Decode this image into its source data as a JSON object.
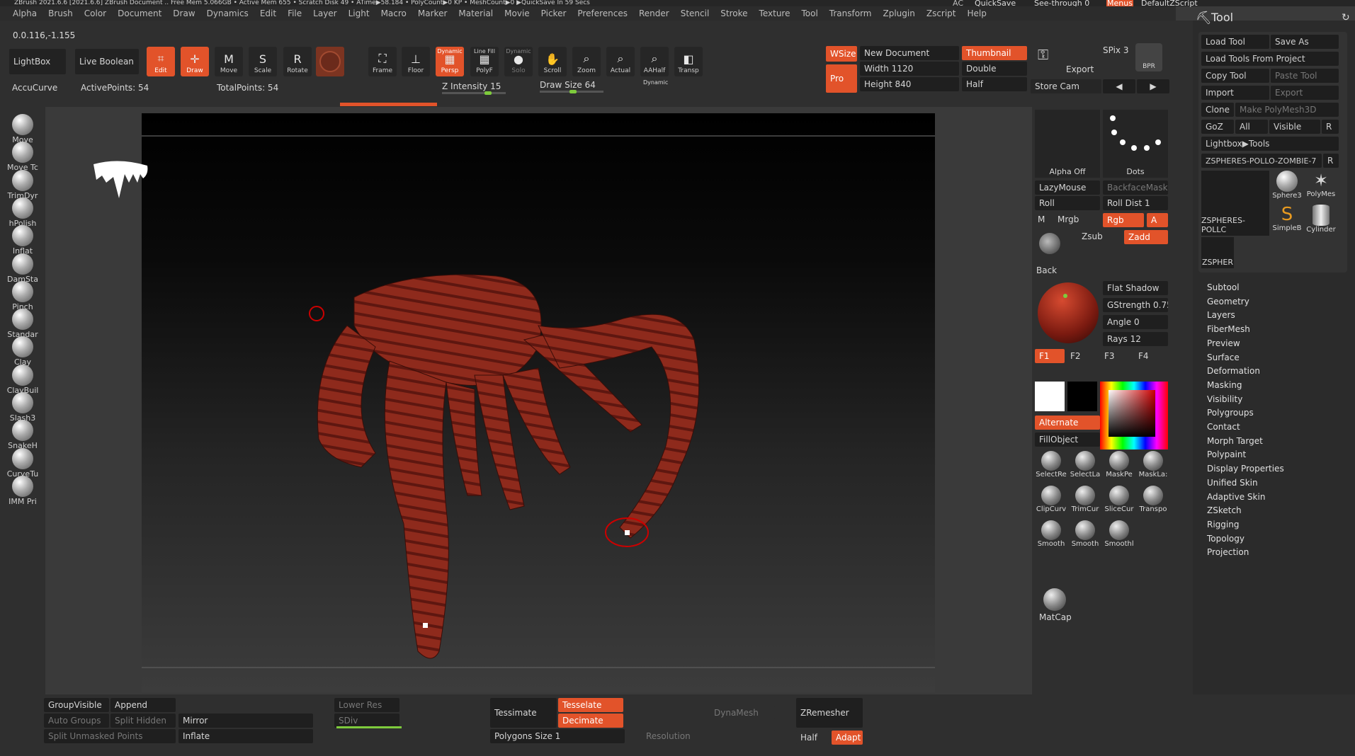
{
  "titlebar": "ZBrush 2021.6.6 [2021.6.6]    ZBrush Document        .. Free Mem 5.066GB • Active Mem 655 • Scratch Disk 49 •   ATime▶58.184 • PolyCount▶0 KP • MeshCount▶0   ▶QuickSave In 59 Secs",
  "title_right": {
    "ac": "AC",
    "quicksave": "QuickSave",
    "seethrough": "See-through  0",
    "menus": "Menus",
    "script": "DefaultZScript"
  },
  "menu": [
    "Alpha",
    "Brush",
    "Color",
    "Document",
    "Draw",
    "Dynamics",
    "Edit",
    "File",
    "Layer",
    "Light",
    "Macro",
    "Marker",
    "Material",
    "Movie",
    "Picker",
    "Preferences",
    "Render",
    "Stencil",
    "Stroke",
    "Texture",
    "Tool",
    "Transform",
    "Zplugin",
    "Zscript",
    "Help"
  ],
  "shelf": {
    "coords": "0.0.116,-1.155",
    "lightbox": "LightBox",
    "live_boolean": "Live Boolean",
    "accucurve": "AccuCurve",
    "active_points": "ActivePoints: 54",
    "total_points": "TotalPoints: 54",
    "edit": "Edit",
    "draw": "Draw",
    "move": "Move",
    "scale": "Scale",
    "rotate": "Rotate",
    "frame": "Frame",
    "floor": "Floor",
    "dynamic": "Dynamic",
    "persp": "Persp",
    "linefill": "Line Fill",
    "polyf": "PolyF",
    "solo_dyn": "Dynamic",
    "solo": "Solo",
    "scroll": "Scroll",
    "zoom": "Zoom",
    "actual": "Actual",
    "aahalf": "AAHalf",
    "dynamic2": "Dynamic",
    "transp": "Transp",
    "zintensity": "Z Intensity 15",
    "drawsize": "Draw Size 64",
    "wsize": "WSize",
    "pro": "Pro",
    "newdoc": "New Document",
    "width": "Width 1120",
    "height": "Height 840",
    "thumbnail": "Thumbnail",
    "double": "Double",
    "half": "Half",
    "export": "Export",
    "storecam": "Store Cam",
    "spix": "SPix 3",
    "bpr": "BPR"
  },
  "brushes": [
    "Move",
    "Move Tc",
    "TrimDyr",
    "hPolish",
    "Inflat",
    "DamSta",
    "Pinch",
    "Standar",
    "Clay",
    "ClayBuil",
    "Slash3",
    "SnakeH",
    "CurveTu",
    "IMM Pri"
  ],
  "side": {
    "alpha_off": "Alpha Off",
    "dots": "Dots",
    "lazymouse": "LazyMouse",
    "backfacemask": "BackfaceMask",
    "roll": "Roll",
    "rolldist": "Roll Dist 1",
    "m": "M",
    "mrgb": "Mrgb",
    "rgb": "Rgb",
    "a": "A",
    "zsub": "Zsub",
    "zadd": "Zadd",
    "back": "Back",
    "flatshadow": "Flat Shadow",
    "gstrength": "GStrength 0.75",
    "angle": "Angle 0",
    "rays": "Rays 12",
    "f1": "F1",
    "f2": "F2",
    "f3": "F3",
    "f4": "F4",
    "alternate": "Alternate",
    "fillobject": "FillObject",
    "tools": [
      "SelectRe",
      "SelectLa",
      "MaskPe",
      "MaskLa:",
      "ClipCurv",
      "TrimCur",
      "SliceCur",
      "Transpo",
      "Smooth",
      "Smooth",
      "Smoothl"
    ],
    "matcap": "MatCap"
  },
  "tool": {
    "title": "Tool",
    "load": "Load Tool",
    "saveas": "Save As",
    "loadproj": "Load Tools From Project",
    "copy": "Copy Tool",
    "paste": "Paste Tool",
    "import": "Import",
    "export": "Export",
    "clone": "Clone",
    "make": "Make PolyMesh3D",
    "goz": "GoZ",
    "all": "All",
    "visible": "Visible",
    "r": "R",
    "lightbox": "Lightbox▶Tools",
    "current": "ZSPHERES-POLLO-ZOMBIE-7",
    "r2": "R",
    "thumbs": [
      "ZSPHERES-POLLC",
      "Sphere3",
      "PolyMes",
      "SimpleB",
      "Cylinder",
      "ZSPHER"
    ],
    "items": [
      "Subtool",
      "Geometry",
      "Layers",
      "FiberMesh",
      "Preview",
      "Surface",
      "Deformation",
      "Masking",
      "Visibility",
      "Polygroups",
      "Contact",
      "Morph Target",
      "Polypaint",
      "Display Properties",
      "Unified Skin",
      "Adaptive Skin",
      "ZSketch",
      "Rigging",
      "Topology",
      "Projection"
    ]
  },
  "bottom": {
    "groupvisible": "GroupVisible",
    "append": "Append",
    "autogroups": "Auto Groups",
    "splithidden": "Split Hidden",
    "mirror": "Mirror",
    "splitunmasked": "Split Unmasked Points",
    "inflate": "Inflate",
    "lowerres": "Lower Res",
    "sdiv": "SDiv",
    "tessimate": "Tessimate",
    "tesselate": "Tesselate",
    "decimate": "Decimate",
    "polysize": "Polygons Size  1",
    "dynamesh": "DynaMesh",
    "resolution": "Resolution",
    "zremesher": "ZRemesher",
    "half": "Half",
    "adapt": "Adapt"
  },
  "colors": {
    "accent": "#e2532a",
    "slider": "#7ecb3c"
  }
}
